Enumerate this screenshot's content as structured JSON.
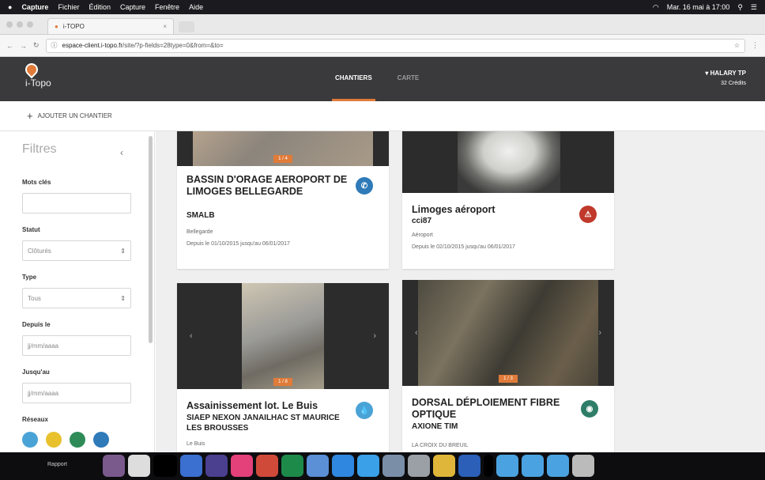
{
  "menubar": {
    "items": [
      "Capture",
      "Fichier",
      "Édition",
      "Capture",
      "Fenêtre",
      "Aide"
    ],
    "clock": "Mar. 16 mai à 17:00"
  },
  "browser": {
    "tab_title": "i-TOPO",
    "url_host": "espace-client.i-topo.fr",
    "url_path": "/site/?p-fields=28type=0&from=&to="
  },
  "app": {
    "logo_text": "i-Topo",
    "nav": [
      {
        "label": "CHANTIERS",
        "active": true
      },
      {
        "label": "CARTE",
        "active": false
      }
    ],
    "user_name": "HALARY TP",
    "user_credits": "32 Crédits"
  },
  "toolbar": {
    "add_label": "AJOUTER UN CHANTIER"
  },
  "filters": {
    "title": "Filtres",
    "collapse": "‹",
    "keywords_label": "Mots clés",
    "keywords_value": "",
    "status_label": "Statut",
    "status_value": "Clôturés",
    "type_label": "Type",
    "type_value": "Tous",
    "from_label": "Depuis le",
    "from_placeholder": "jj/mm/aaaa",
    "to_label": "Jusqu'au",
    "to_placeholder": "jj/mm/aaaa",
    "networks_label": "Réseaux",
    "network_colors": [
      "#4aa3d6",
      "#e8c12c",
      "#2e8b57",
      "#2f7ab8"
    ]
  },
  "cards": [
    {
      "title": "BASSIN D'ORAGE AEROPORT DE LIMOGES BELLEGARDE",
      "client": "SMALB",
      "place": "Bellegarde",
      "dates": "Depuis le 01/10/2015 jusqu'au 06/01/2017",
      "badge": "1 / 4",
      "icon": "phone",
      "icon_color": "#2f7ab8"
    },
    {
      "title": "Limoges aéroport",
      "client": "cci87",
      "place": "Aéroport",
      "dates": "Depuis le 02/10/2015 jusqu'au 06/01/2017",
      "icon": "warning",
      "icon_color": "#c0392b"
    },
    {
      "title": "Assainissement lot. Le Buis",
      "client": "SIAEP NEXON JANAILHAC ST MAURICE LES BROUSSES",
      "place": "Le Buis",
      "badge": "1 / 8",
      "icon": "drop",
      "icon_color": "#4aa3d6"
    },
    {
      "title": "DORSAL DÉPLOIEMENT FIBRE OPTIQUE",
      "client": "AXIONE TIM",
      "place": "LA CROIX DU BREUIL",
      "badge": "1 / 3",
      "icon": "fiber",
      "icon_color": "#2e7d68"
    }
  ],
  "dock": {
    "label": "Rapport"
  }
}
